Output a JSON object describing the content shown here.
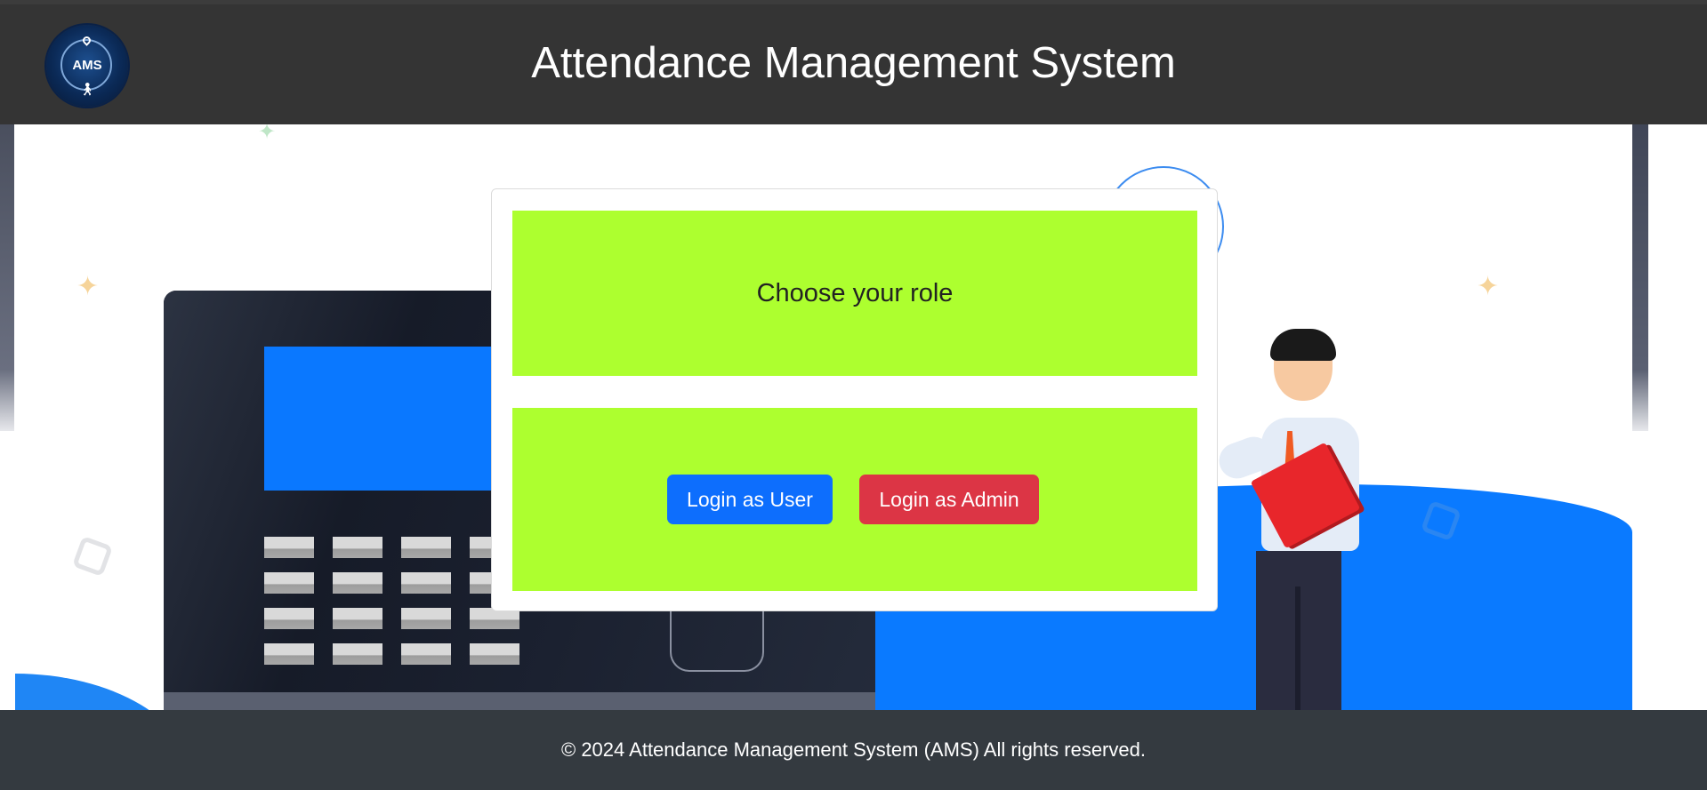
{
  "header": {
    "logo_text": "AMS",
    "title": "Attendance Management System"
  },
  "card": {
    "title": "Choose your role",
    "buttons": {
      "user_label": "Login as User",
      "admin_label": "Login as Admin"
    }
  },
  "footer": {
    "text": "© 2024 Attendance Management System (AMS) All rights reserved."
  },
  "colors": {
    "header_bg": "#343434",
    "card_panel": "#adff2f",
    "user_button": "#0d6efd",
    "admin_button": "#dc3545",
    "footer_bg": "#343a40",
    "hero_blue": "#0a7aff"
  },
  "icons": {
    "logo": "ams-logo-icon",
    "location": "location-pin-icon",
    "person": "person-icon"
  }
}
